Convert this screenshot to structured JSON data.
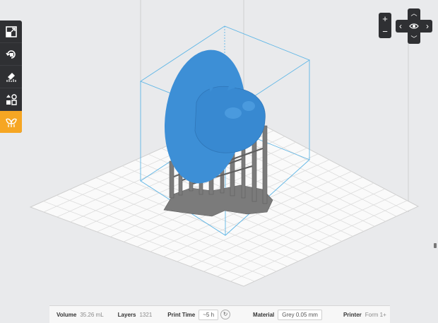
{
  "colors": {
    "model": "#3d8fd6",
    "supports": "#7b7b7b",
    "accent": "#f6a623",
    "toolbar": "#2f3033",
    "bbox": "#5fb6e6",
    "grid": "#d9d9d9"
  },
  "toolbar": {
    "items": [
      {
        "icon": "scale-icon"
      },
      {
        "icon": "rotate-icon"
      },
      {
        "icon": "orientation-icon"
      },
      {
        "icon": "layout-icon"
      },
      {
        "icon": "supports-icon",
        "active": true
      }
    ]
  },
  "view_controls": {
    "zoom_in": "+",
    "zoom_out": "−",
    "up": "︿",
    "down": "﹀",
    "left": "‹",
    "right": "›"
  },
  "status": {
    "volume_label": "Volume",
    "volume_value": "35.26 mL",
    "layers_label": "Layers",
    "layers_value": "1321",
    "print_time_label": "Print Time",
    "print_time_value": "~5 h",
    "material_label": "Material",
    "material_value": "Grey 0.05 mm",
    "printer_label": "Printer",
    "printer_value": "Form 1+"
  }
}
